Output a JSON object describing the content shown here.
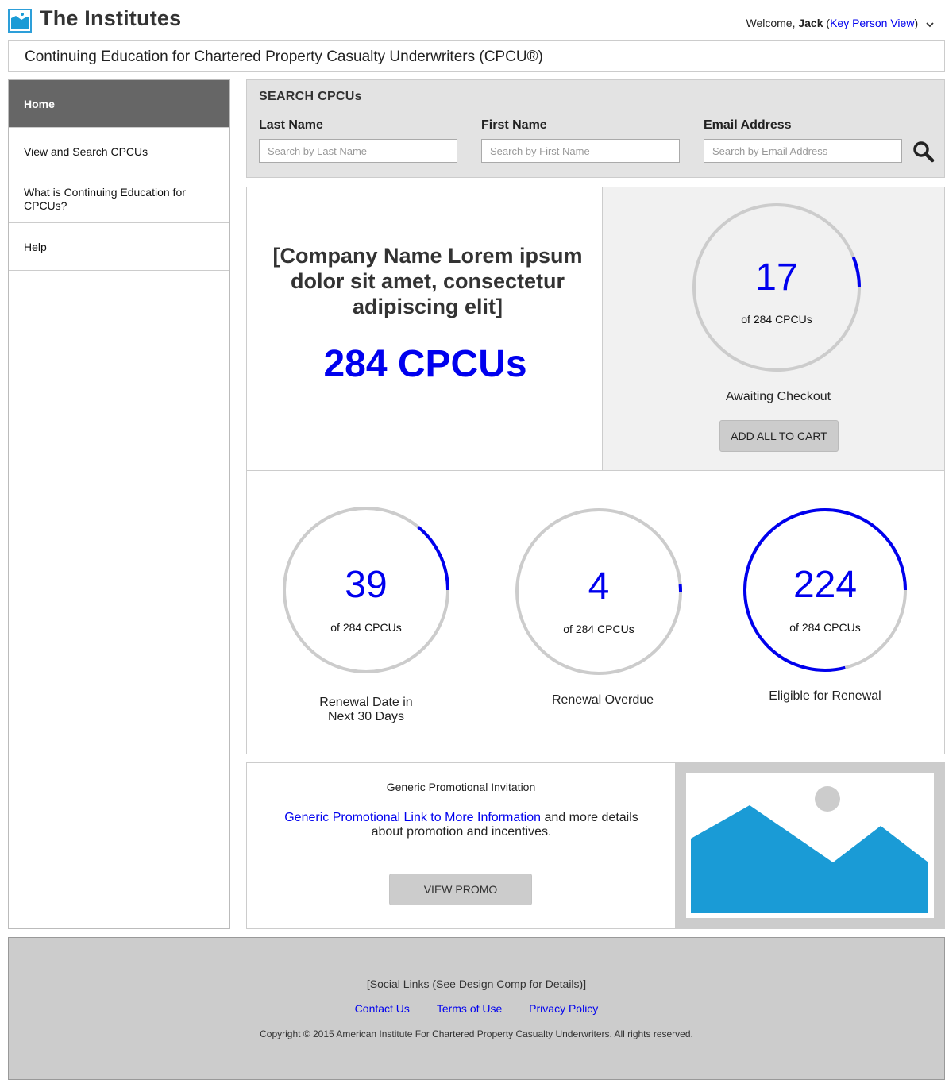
{
  "header": {
    "logo_text": "The Institutes",
    "welcome_prefix": "Welcome, ",
    "user_name": "Jack",
    "view_link": "Key Person View",
    "open_paren": " (",
    "close_paren": ")"
  },
  "subtitle": "Continuing Education for Chartered Property Casualty Underwriters (CPCU®)",
  "sidebar": {
    "items": [
      {
        "label": "Home",
        "active": true
      },
      {
        "label": "View and Search CPCUs"
      },
      {
        "label": "What is Continuing Education for CPCUs?"
      },
      {
        "label": "Help"
      }
    ]
  },
  "search": {
    "title": "SEARCH CPCUs",
    "last_name_label": "Last Name",
    "last_name_placeholder": "Search by Last Name",
    "first_name_label": "First Name",
    "first_name_placeholder": "Search by First Name",
    "email_label": "Email Address",
    "email_placeholder": "Search by Email Address"
  },
  "company": {
    "name": "[Company Name Lorem ipsum dolor sit amet, consectetur adipiscing elit]",
    "count": "284 CPCUs"
  },
  "checkout": {
    "value": "17",
    "sub": "of 284 CPCUs",
    "fraction": 0.06,
    "caption": "Awaiting Checkout",
    "button": "ADD ALL TO CART"
  },
  "stats": [
    {
      "value": "39",
      "sub": "of 284 CPCUs",
      "fraction": 0.14,
      "caption_line1": "Renewal Date in",
      "caption_line2": "Next 30 Days"
    },
    {
      "value": "4",
      "sub": "of 284 CPCUs",
      "fraction": 0.014,
      "caption_line1": "Renewal Overdue",
      "caption_line2": ""
    },
    {
      "value": "224",
      "sub": "of 284 CPCUs",
      "fraction": 0.79,
      "caption_line1": "Eligible for Renewal",
      "caption_line2": ""
    }
  ],
  "promo": {
    "title": "Generic Promotional Invitation",
    "link_text": "Generic Promotional Link to More Information",
    "body_text": " and more details about promotion and incentives.",
    "button": "VIEW PROMO"
  },
  "footer": {
    "social": "[Social Links (See Design Comp for Details)]",
    "links": [
      "Contact Us",
      "Terms of Use",
      "Privacy Policy"
    ],
    "copyright": "Copyright © 2015 American Institute For Chartered Property Casualty Underwriters. All rights reserved."
  },
  "colors": {
    "accent": "#0000ee",
    "ring_track": "#cccccc",
    "image_blue": "#1a9bd6",
    "nav_active": "#666666"
  },
  "icons": [
    "logo-icon",
    "chevron-down-icon",
    "search-icon",
    "image-placeholder-icon"
  ]
}
